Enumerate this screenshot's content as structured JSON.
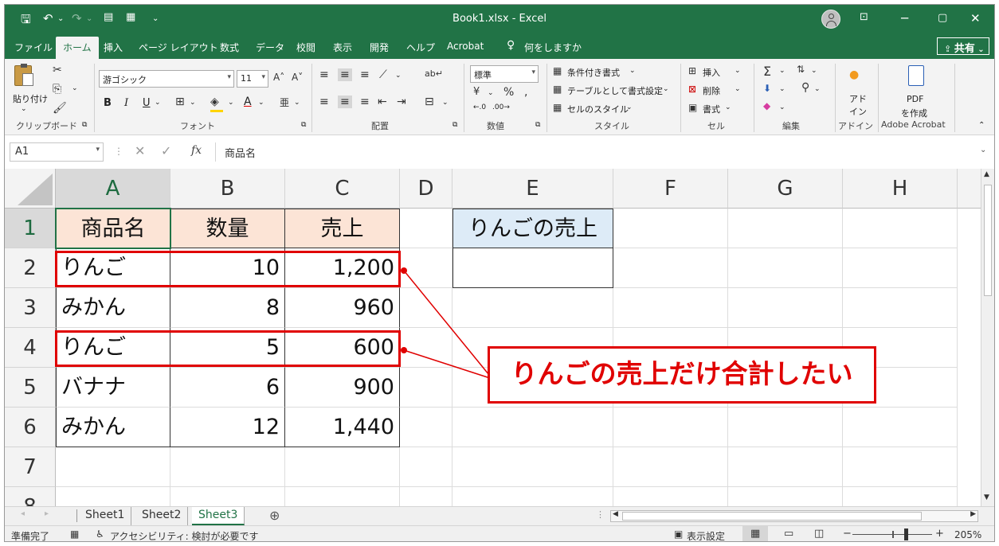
{
  "title": "Book1.xlsx  -  Excel",
  "qat": {
    "save_icon": "save-icon",
    "undo_icon": "undo-icon",
    "redo_icon": "redo-icon"
  },
  "menu": {
    "file": "ファイル",
    "home": "ホーム",
    "insert": "挿入",
    "page_layout": "ページ レイアウト",
    "formulas": "数式",
    "data": "データ",
    "review": "校閲",
    "view": "表示",
    "developer": "開発",
    "help": "ヘルプ",
    "acrobat": "Acrobat",
    "tell_me": "何をしますか",
    "share": "共有"
  },
  "ribbon": {
    "paste": "貼り付け",
    "clipboard": "クリップボード",
    "font_name": "游ゴシック",
    "font_size": "11",
    "font": "フォント",
    "bold": "B",
    "italic": "I",
    "underline": "U",
    "alignment": "配置",
    "number_format": "標準",
    "number": "数値",
    "conditional": "条件付き書式",
    "format_table": "テーブルとして書式設定",
    "cell_styles": "セルのスタイル",
    "styles": "スタイル",
    "insert": "挿入",
    "delete": "削除",
    "format": "書式",
    "cells": "セル",
    "editing": "編集",
    "addins_line1": "アド",
    "addins_line2": "イン",
    "addins": "アドイン",
    "pdf_line1": "PDF",
    "pdf_line2": "を作成",
    "adobe": "Adobe Acrobat"
  },
  "formula_bar": {
    "name_box": "A1",
    "fx": "fx",
    "content": "商品名"
  },
  "columns": [
    "A",
    "B",
    "C",
    "D",
    "E",
    "F",
    "G",
    "H"
  ],
  "rows": [
    "1",
    "2",
    "3",
    "4",
    "5",
    "6",
    "7",
    "8"
  ],
  "cells": {
    "A1": "商品名",
    "B1": "数量",
    "C1": "売上",
    "E1": "りんごの売上",
    "A2": "りんご",
    "B2": "10",
    "C2": "1,200",
    "A3": "みかん",
    "B3": "8",
    "C3": "960",
    "A4": "りんご",
    "B4": "5",
    "C4": "600",
    "A5": "バナナ",
    "B5": "6",
    "C5": "900",
    "A6": "みかん",
    "B6": "12",
    "C6": "1,440"
  },
  "annotation": "りんごの売上だけ合計したい",
  "colors": {
    "excel_green": "#217346",
    "header_fill": "#fce4d6",
    "e1_fill": "#ddebf7",
    "highlight_red": "#e00000"
  },
  "sheets": [
    "Sheet1",
    "Sheet2",
    "Sheet3"
  ],
  "status": {
    "ready": "準備完了",
    "accessibility": "アクセシビリティ: 検討が必要です",
    "display_settings": "表示設定",
    "zoom": "205%"
  }
}
